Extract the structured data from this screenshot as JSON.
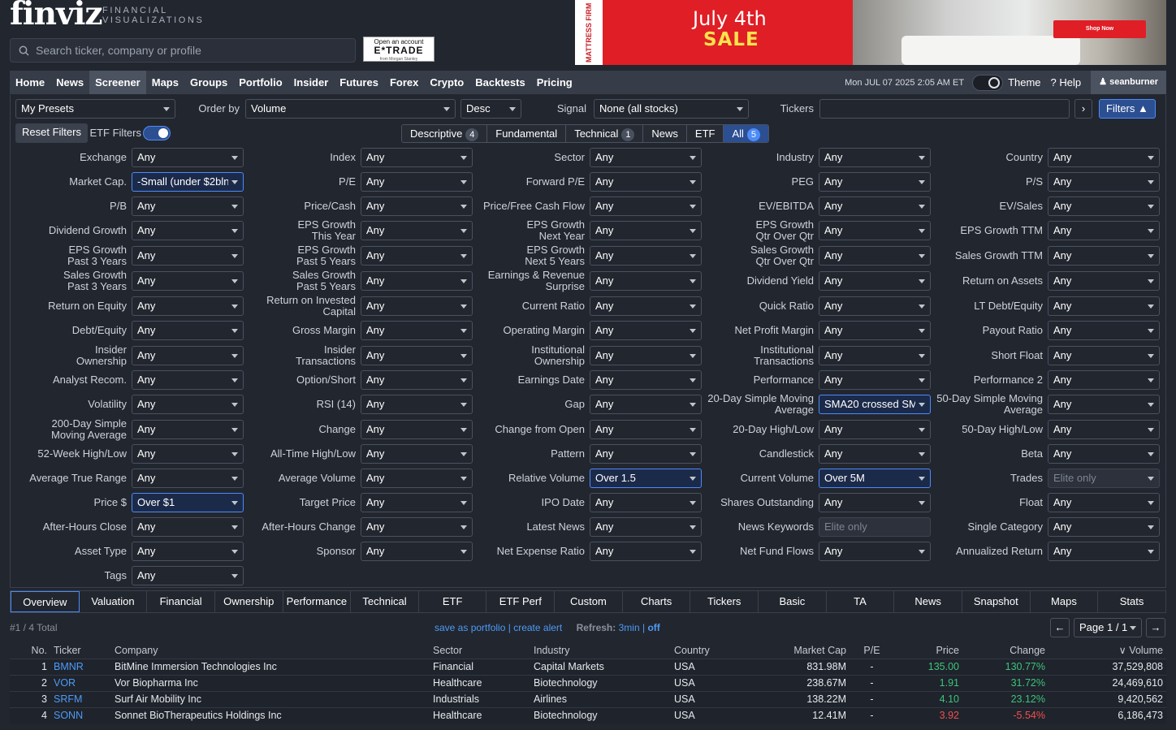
{
  "header": {
    "logo": "finviz",
    "logo_sub1": "FINANCIAL",
    "logo_sub2": "VISUALIZATIONS",
    "search_placeholder": "Search ticker, company or profile",
    "etrade_top": "Open an account",
    "etrade_brand": "E*TRADE",
    "etrade_sub": "from Morgan Stanley"
  },
  "ad": {
    "brand": "MATTRESS FIRM",
    "line1": "July 4th",
    "line2": "SALE",
    "cta": "Shop Now"
  },
  "nav": {
    "items": [
      "Home",
      "News",
      "Screener",
      "Maps",
      "Groups",
      "Portfolio",
      "Insider",
      "Futures",
      "Forex",
      "Crypto",
      "Backtests",
      "Pricing"
    ],
    "datetime": "Mon JUL 07 2025 2:05 AM ET",
    "theme": "Theme",
    "help": "Help",
    "user": "seanburner"
  },
  "controls": {
    "presets": "My Presets",
    "order_label": "Order by",
    "order_value": "Volume",
    "direction": "Desc",
    "signal_label": "Signal",
    "signal_value": "None (all stocks)",
    "tickers_label": "Tickers",
    "filters_btn": "Filters",
    "reset": "Reset Filters",
    "etf_filters": "ETF Filters"
  },
  "filter_tabs": [
    {
      "label": "Descriptive",
      "badge": "4"
    },
    {
      "label": "Fundamental",
      "badge": ""
    },
    {
      "label": "Technical",
      "badge": "1"
    },
    {
      "label": "News",
      "badge": ""
    },
    {
      "label": "ETF",
      "badge": ""
    },
    {
      "label": "All",
      "badge": "5"
    }
  ],
  "filters": [
    [
      [
        "Exchange",
        "Any"
      ],
      [
        "Index",
        "Any"
      ],
      [
        "Sector",
        "Any"
      ],
      [
        "Industry",
        "Any"
      ],
      [
        "Country",
        "Any"
      ]
    ],
    [
      [
        "Market Cap.",
        "-Small (under $2bln)"
      ],
      [
        "P/E",
        "Any"
      ],
      [
        "Forward P/E",
        "Any"
      ],
      [
        "PEG",
        "Any"
      ],
      [
        "P/S",
        "Any"
      ]
    ],
    [
      [
        "P/B",
        "Any"
      ],
      [
        "Price/Cash",
        "Any"
      ],
      [
        "Price/Free Cash Flow",
        "Any"
      ],
      [
        "EV/EBITDA",
        "Any"
      ],
      [
        "EV/Sales",
        "Any"
      ]
    ],
    [
      [
        "Dividend Growth",
        "Any"
      ],
      [
        "EPS Growth\nThis Year",
        "Any"
      ],
      [
        "EPS Growth\nNext Year",
        "Any"
      ],
      [
        "EPS Growth\nQtr Over Qtr",
        "Any"
      ],
      [
        "EPS Growth TTM",
        "Any"
      ]
    ],
    [
      [
        "EPS Growth\nPast 3 Years",
        "Any"
      ],
      [
        "EPS Growth\nPast 5 Years",
        "Any"
      ],
      [
        "EPS Growth\nNext 5 Years",
        "Any"
      ],
      [
        "Sales Growth\nQtr Over Qtr",
        "Any"
      ],
      [
        "Sales Growth TTM",
        "Any"
      ]
    ],
    [
      [
        "Sales Growth\nPast 3 Years",
        "Any"
      ],
      [
        "Sales Growth\nPast 5 Years",
        "Any"
      ],
      [
        "Earnings & Revenue\nSurprise",
        "Any"
      ],
      [
        "Dividend Yield",
        "Any"
      ],
      [
        "Return on Assets",
        "Any"
      ]
    ],
    [
      [
        "Return on Equity",
        "Any"
      ],
      [
        "Return on Invested\nCapital",
        "Any"
      ],
      [
        "Current Ratio",
        "Any"
      ],
      [
        "Quick Ratio",
        "Any"
      ],
      [
        "LT Debt/Equity",
        "Any"
      ]
    ],
    [
      [
        "Debt/Equity",
        "Any"
      ],
      [
        "Gross Margin",
        "Any"
      ],
      [
        "Operating Margin",
        "Any"
      ],
      [
        "Net Profit Margin",
        "Any"
      ],
      [
        "Payout Ratio",
        "Any"
      ]
    ],
    [
      [
        "Insider\nOwnership",
        "Any"
      ],
      [
        "Insider\nTransactions",
        "Any"
      ],
      [
        "Institutional\nOwnership",
        "Any"
      ],
      [
        "Institutional\nTransactions",
        "Any"
      ],
      [
        "Short Float",
        "Any"
      ]
    ],
    [
      [
        "Analyst Recom.",
        "Any"
      ],
      [
        "Option/Short",
        "Any"
      ],
      [
        "Earnings Date",
        "Any"
      ],
      [
        "Performance",
        "Any"
      ],
      [
        "Performance 2",
        "Any"
      ]
    ],
    [
      [
        "Volatility",
        "Any"
      ],
      [
        "RSI (14)",
        "Any"
      ],
      [
        "Gap",
        "Any"
      ],
      [
        "20-Day Simple Moving\nAverage",
        "SMA20 crossed SMA50"
      ],
      [
        "50-Day Simple Moving\nAverage",
        "Any"
      ]
    ],
    [
      [
        "200-Day Simple\nMoving Average",
        "Any"
      ],
      [
        "Change",
        "Any"
      ],
      [
        "Change from Open",
        "Any"
      ],
      [
        "20-Day High/Low",
        "Any"
      ],
      [
        "50-Day High/Low",
        "Any"
      ]
    ],
    [
      [
        "52-Week High/Low",
        "Any"
      ],
      [
        "All-Time High/Low",
        "Any"
      ],
      [
        "Pattern",
        "Any"
      ],
      [
        "Candlestick",
        "Any"
      ],
      [
        "Beta",
        "Any"
      ]
    ],
    [
      [
        "Average True Range",
        "Any"
      ],
      [
        "Average Volume",
        "Any"
      ],
      [
        "Relative Volume",
        "Over 1.5"
      ],
      [
        "Current Volume",
        "Over 5M"
      ],
      [
        "Trades",
        "Elite only"
      ]
    ],
    [
      [
        "Price $",
        "Over $1"
      ],
      [
        "Target Price",
        "Any"
      ],
      [
        "IPO Date",
        "Any"
      ],
      [
        "Shares Outstanding",
        "Any"
      ],
      [
        "Float",
        "Any"
      ]
    ],
    [
      [
        "After-Hours Close",
        "Any"
      ],
      [
        "After-Hours Change",
        "Any"
      ],
      [
        "Latest News",
        "Any"
      ],
      [
        "News Keywords",
        "Elite only"
      ],
      [
        "Single Category",
        "Any"
      ]
    ],
    [
      [
        "Asset Type",
        "Any"
      ],
      [
        "Sponsor",
        "Any"
      ],
      [
        "Net Expense Ratio",
        "Any"
      ],
      [
        "Net Fund Flows",
        "Any"
      ],
      [
        "Annualized Return",
        "Any"
      ]
    ],
    [
      [
        "Tags",
        "Any"
      ]
    ]
  ],
  "view_tabs": [
    "Overview",
    "Valuation",
    "Financial",
    "Ownership",
    "Performance",
    "Technical",
    "ETF",
    "ETF Perf",
    "Custom",
    "Charts",
    "Tickers",
    "Basic",
    "TA",
    "News",
    "Snapshot",
    "Maps",
    "Stats"
  ],
  "results": {
    "total": "#1 / 4 Total",
    "save": "save as portfolio",
    "alert": "create alert",
    "refresh_label": "Refresh:",
    "refresh_value": "3min",
    "refresh_off": "off",
    "page": "Page 1 / 1"
  },
  "table": {
    "headers": [
      "No.",
      "Ticker",
      "Company",
      "Sector",
      "Industry",
      "Country",
      "Market Cap",
      "P/E",
      "Price",
      "Change",
      "Volume"
    ],
    "rows": [
      [
        "1",
        "BMNR",
        "BitMine Immersion Technologies Inc",
        "Financial",
        "Capital Markets",
        "USA",
        "831.98M",
        "-",
        "135.00",
        "130.77%",
        "37,529,808"
      ],
      [
        "2",
        "VOR",
        "Vor Biopharma Inc",
        "Healthcare",
        "Biotechnology",
        "USA",
        "238.67M",
        "-",
        "1.91",
        "31.72%",
        "24,469,610"
      ],
      [
        "3",
        "SRFM",
        "Surf Air Mobility Inc",
        "Industrials",
        "Airlines",
        "USA",
        "138.22M",
        "-",
        "4.10",
        "23.12%",
        "9,420,562"
      ],
      [
        "4",
        "SONN",
        "Sonnet BioTherapeutics Holdings Inc",
        "Healthcare",
        "Biotechnology",
        "USA",
        "12.41M",
        "-",
        "3.92",
        "-5.54%",
        "6,186,473"
      ]
    ]
  },
  "colors": {
    "accent": "#4d8bf7",
    "up": "#3cc47c",
    "down": "#f05050",
    "bg": "#22262f"
  }
}
